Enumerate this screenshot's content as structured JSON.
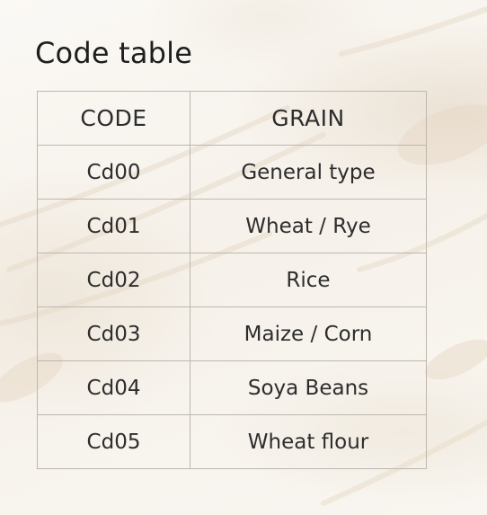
{
  "title": "Code table",
  "table": {
    "headers": [
      "CODE",
      "GRAIN"
    ],
    "rows": [
      [
        "Cd00",
        "General type"
      ],
      [
        "Cd01",
        "Wheat / Rye"
      ],
      [
        "Cd02",
        "Rice"
      ],
      [
        "Cd03",
        "Maize / Corn"
      ],
      [
        "Cd04",
        "Soya Beans"
      ],
      [
        "Cd05",
        "Wheat flour"
      ]
    ]
  },
  "colors": {
    "background": "#f7f3ed",
    "border": "#bdb7ae",
    "text": "#2d2d2d"
  }
}
